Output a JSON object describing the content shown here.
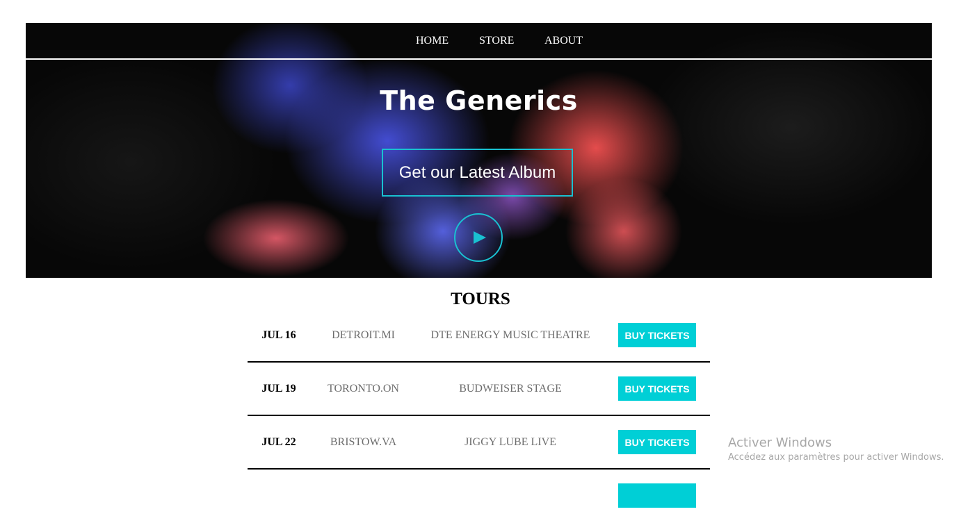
{
  "nav": {
    "items": [
      {
        "label": "HOME"
      },
      {
        "label": "STORE"
      },
      {
        "label": "ABOUT"
      }
    ]
  },
  "hero": {
    "title": "The Generics",
    "album_button": "Get our Latest Album",
    "play_icon": "play-icon"
  },
  "colors": {
    "accent": "#00cfd6",
    "accent_border": "#19c1d1",
    "text_muted": "#6d6d6d"
  },
  "tours": {
    "heading": "TOURS",
    "rows": [
      {
        "date": "JUL 16",
        "city": "DETROIT.MI",
        "venue": "DTE ENERGY MUSIC THEATRE",
        "button": "BUY TICKETS"
      },
      {
        "date": "JUL 19",
        "city": "TORONTO.ON",
        "venue": "BUDWEISER STAGE",
        "button": "BUY TICKETS"
      },
      {
        "date": "JUL 22",
        "city": "BRISTOW.VA",
        "venue": "JIGGY LUBE LIVE",
        "button": "BUY TICKETS"
      },
      {
        "date": "",
        "city": "",
        "venue": "",
        "button": ""
      }
    ]
  },
  "watermark": {
    "title": "Activer Windows",
    "subtitle": "Accédez aux paramètres pour activer Windows."
  }
}
